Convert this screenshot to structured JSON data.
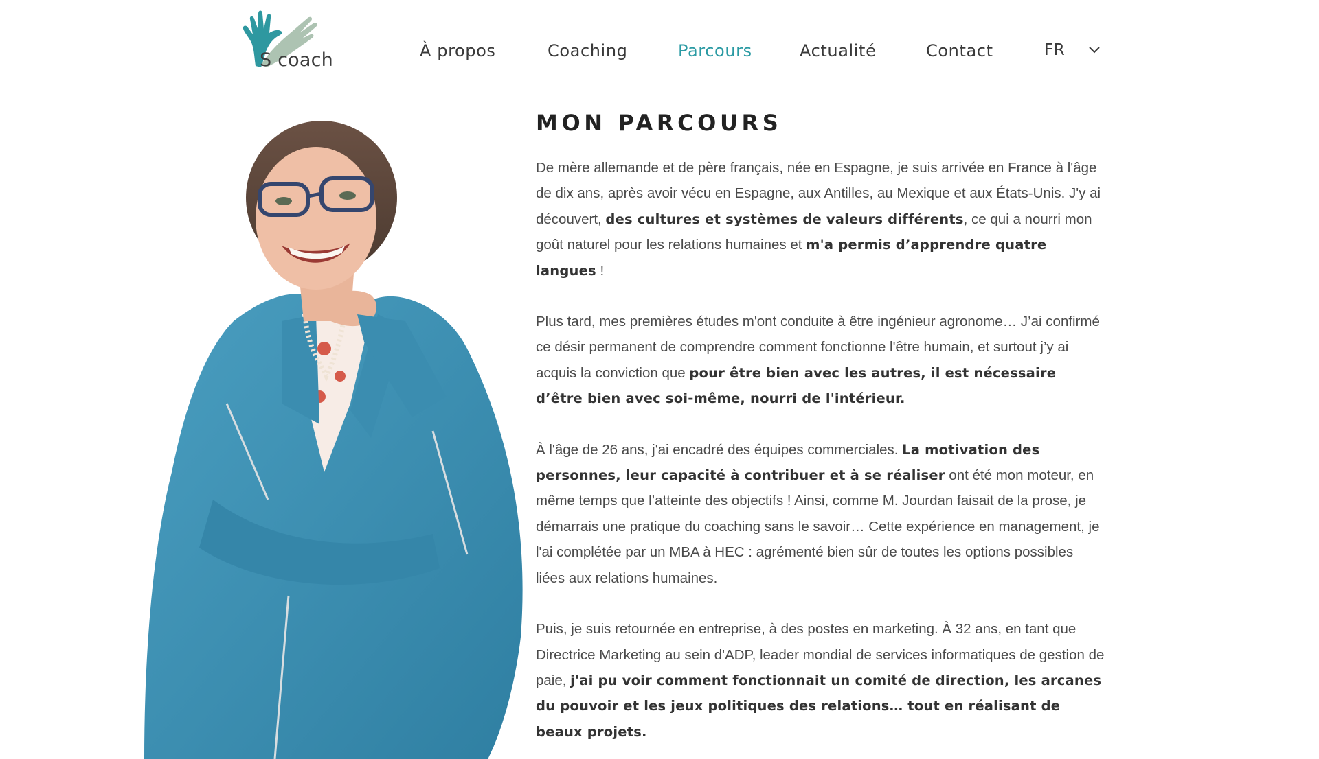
{
  "brand": {
    "logo_text": "S coach"
  },
  "nav": {
    "items": [
      {
        "label": "À propos"
      },
      {
        "label": "Coaching"
      },
      {
        "label": "Parcours",
        "active": true
      },
      {
        "label": "Actualité"
      },
      {
        "label": "Contact"
      }
    ],
    "language": "FR"
  },
  "colors": {
    "accent": "#2a9aa3",
    "jacket": "#3c8fb0",
    "trousers": "#e46a58"
  },
  "main": {
    "title": "MON PARCOURS",
    "paragraphs": [
      {
        "segments": [
          {
            "t": "De mère allemande et de père français, née en Espagne, je suis arrivée en France à l'âge de dix ans, après avoir vécu en Espagne, aux Antilles, au Mexique et aux États-Unis. J'y ai découvert, ",
            "b": false
          },
          {
            "t": "des cultures et systèmes de valeurs différents",
            "b": true
          },
          {
            "t": ", ce qui a nourri mon goût naturel pour les relations humaines et ",
            "b": false
          },
          {
            "t": "m'a permis d’apprendre quatre langues",
            "b": true
          },
          {
            "t": " !",
            "b": false
          }
        ]
      },
      {
        "segments": [
          {
            "t": "Plus tard, mes premières études m'ont conduite à être ingénieur agronome… J’ai confirmé ce désir permanent de comprendre comment fonctionne l'être humain, et surtout j’y ai acquis la conviction que ",
            "b": false
          },
          {
            "t": "pour être bien avec les autres, il est nécessaire d’être bien avec soi-même, nourri de l'intérieur.",
            "b": true
          }
        ]
      },
      {
        "segments": [
          {
            "t": "À l'âge de 26 ans, j'ai encadré des équipes commerciales. ",
            "b": false
          },
          {
            "t": "La motivation des personnes, leur capacité à contribuer et à se réaliser",
            "b": true
          },
          {
            "t": " ont été mon moteur, en même temps que l’atteinte des objectifs ! Ainsi, comme M. Jourdan faisait de la prose, je démarrais une pratique du coaching sans le savoir… Cette expérience en management, je l'ai complétée par un MBA à HEC : agrémenté bien sûr de toutes les options possibles liées aux relations humaines.",
            "b": false
          }
        ]
      },
      {
        "segments": [
          {
            "t": "Puis, je suis retournée en entreprise, à des postes en marketing. À 32 ans, en tant que Directrice Marketing au sein d'ADP, leader mondial de services informatiques de gestion de paie, ",
            "b": false
          },
          {
            "t": "j'ai pu voir comment fonctionnait un comité de direction, les arcanes du pouvoir et les jeux politiques des relations… tout en réalisant de beaux projets.",
            "b": true
          }
        ]
      }
    ]
  }
}
